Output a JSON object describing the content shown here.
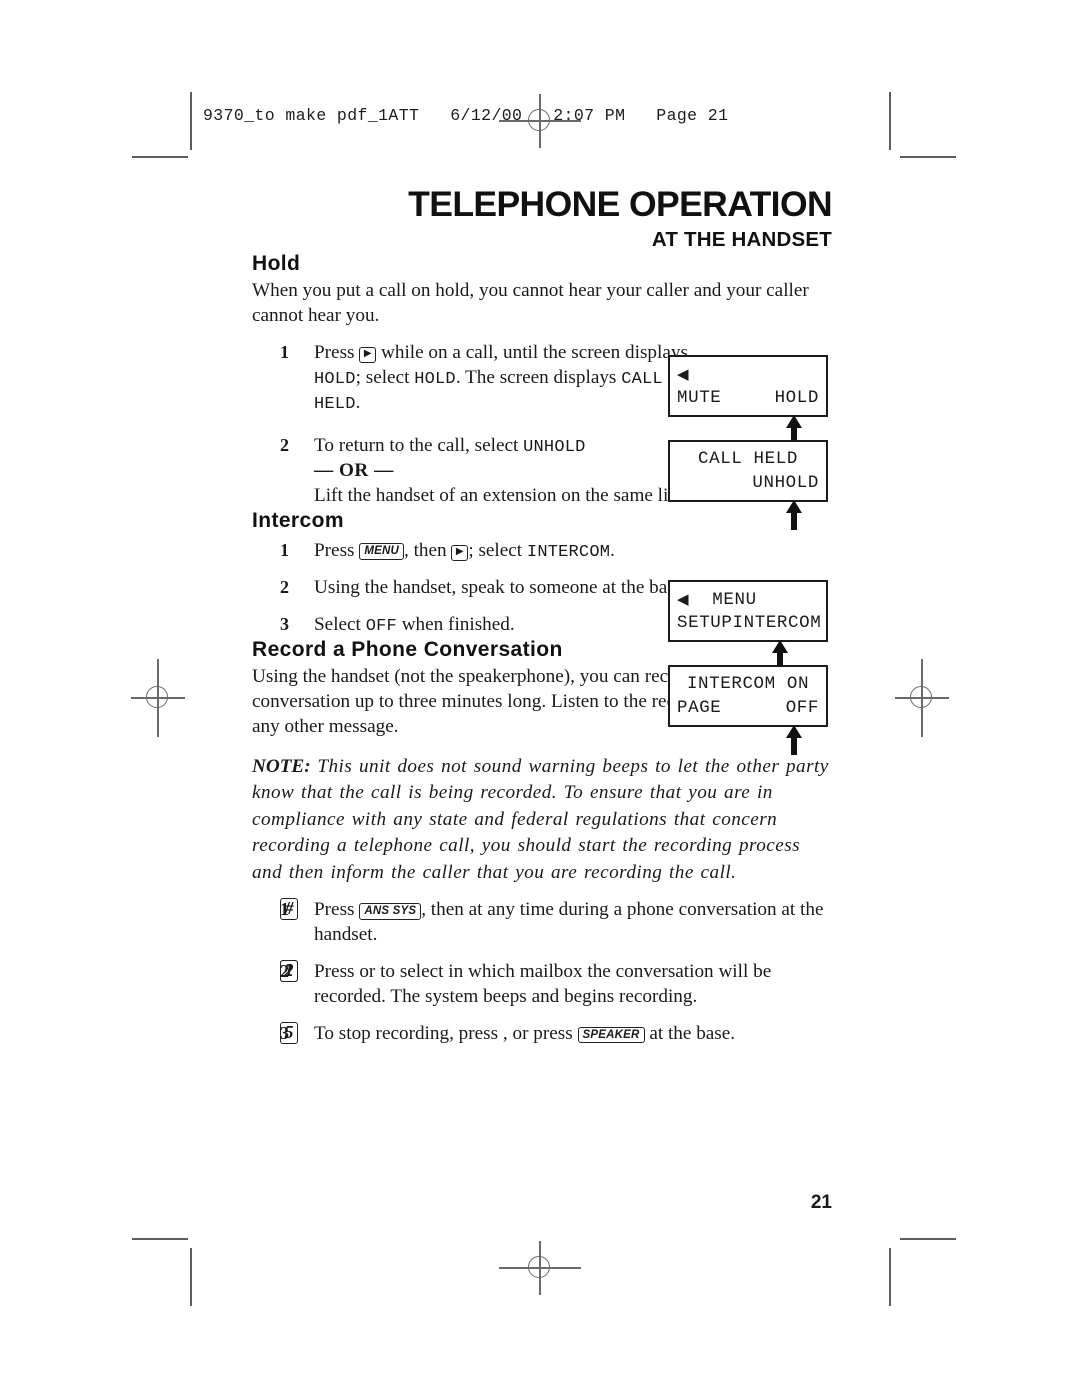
{
  "slug": {
    "text": "9370_to make pdf_1ATT   6/12/00   2:07 PM   Page 21"
  },
  "header": {
    "title": "TELEPHONE OPERATION",
    "subtitle": "AT THE HANDSET"
  },
  "sections": {
    "hold": {
      "heading": "Hold",
      "intro": "When you put a call on hold, you cannot hear your caller and your caller cannot hear you.",
      "steps": [
        {
          "num": "1",
          "pre": "Press",
          "key": "▶",
          "mid": "while on a call, until the screen displays",
          "term1": "HOLD",
          "mid2": "; select",
          "term2": "HOLD",
          "mid3": ". The screen displays",
          "term3": "CALL HELD",
          "end": "."
        },
        {
          "num": "2",
          "line1_pre": "To return to the call, select",
          "line1_term": "UNHOLD",
          "or": "— OR —",
          "line2": "Lift the handset of an extension on the same line."
        }
      ]
    },
    "intercom": {
      "heading": "Intercom",
      "steps": [
        {
          "num": "1",
          "pre": "Press",
          "key1": "MENU",
          "mid": ", then",
          "key2": "▶",
          "mid2": "; select",
          "term": "INTERCOM",
          "end": "."
        },
        {
          "num": "2",
          "text": "Using the handset, speak to someone at the base."
        },
        {
          "num": "3",
          "pre": "Select",
          "term": "OFF",
          "post": "when finished."
        }
      ]
    },
    "record": {
      "heading": "Record a Phone Conversation",
      "intro": "Using the handset (not the speakerphone), you can record a phone conversation up to three minutes long.  Listen to the recording as you do any other message.",
      "note_label": "NOTE:",
      "note": "This unit does not sound warning beeps to let the other party know that the call is being recorded. To ensure that you are in compliance with any state and federal regulations that concern recording a telephone call, you should start the recording process and then inform the caller that you are recording the call.",
      "steps": [
        {
          "num": "1",
          "pre": "Press",
          "key1": "ANS SYS",
          "mid": ", then",
          "key2": "#",
          "post": "at any time during a phone conversation at the handset."
        },
        {
          "num": "2",
          "pre": "Press",
          "key1": "1",
          "mid": "or",
          "key2": "2",
          "post": "to select in which mailbox the conversation will be recorded.  The system beeps and begins recording."
        },
        {
          "num": "3",
          "pre": "To stop recording, press",
          "key1": "5",
          "mid": ", or press",
          "key2": "SPEAKER",
          "post": "at the base."
        }
      ]
    }
  },
  "lcds": [
    {
      "id": "lcd-mute-hold",
      "caret": "◀",
      "row1_left": "",
      "row1_center": "",
      "row2_left": "MUTE",
      "row2_right": "HOLD"
    },
    {
      "id": "lcd-call-held",
      "caret": "",
      "row1_center": "CALL HELD",
      "row2_right": "UNHOLD"
    },
    {
      "id": "lcd-menu",
      "caret": "◀",
      "row1_center": "MENU",
      "row2_left": "SETUP",
      "row2_right": "INTERCOM"
    },
    {
      "id": "lcd-intercom-on",
      "caret": "",
      "row1_center": "INTERCOM ON",
      "row2_left": "PAGE",
      "row2_right": "OFF"
    }
  ],
  "folio": "21"
}
